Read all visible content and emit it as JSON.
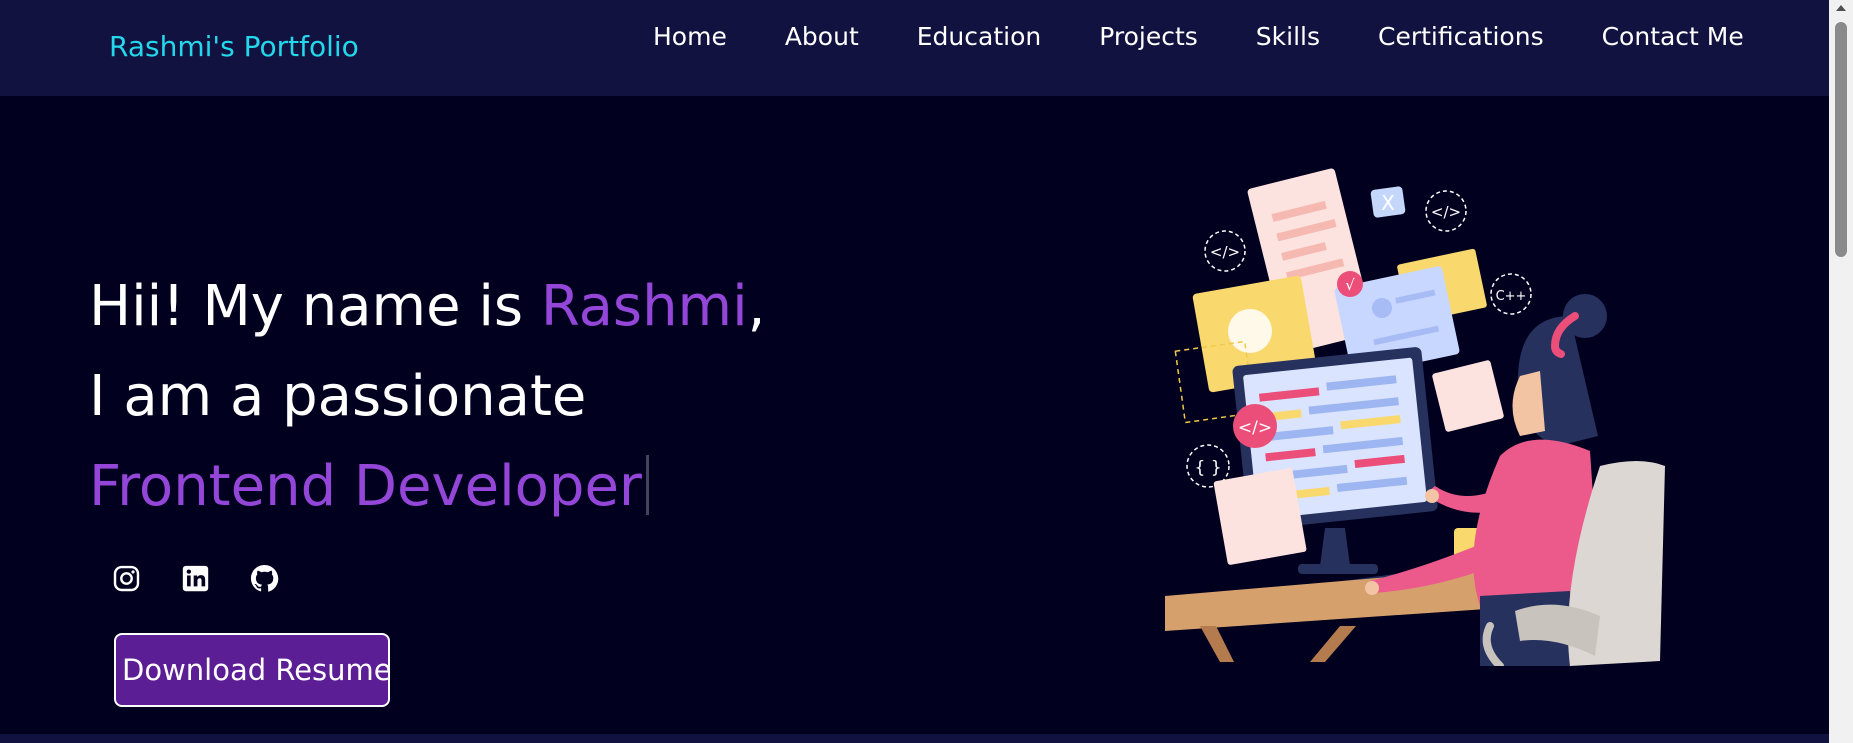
{
  "nav": {
    "brand": "Rashmi's Portfolio",
    "items": [
      "Home",
      "About",
      "Education",
      "Projects",
      "Skills",
      "Certifications",
      "Contact Me"
    ]
  },
  "hero": {
    "line1_prefix": "Hii! My name is ",
    "line1_name": "Rashmi",
    "line1_suffix": ",",
    "line2": "I am a passionate",
    "line3": "Frontend Developer"
  },
  "socials": [
    "instagram-icon",
    "linkedin-icon",
    "github-icon"
  ],
  "resume_button": "Download Resume",
  "illustration": {
    "badge_x": "X",
    "code_tag": "</>",
    "braces": "{ }",
    "cpp": "C++",
    "check": "√"
  },
  "colors": {
    "nav_bg": "#121241",
    "page_bg": "#02001f",
    "brand": "#22d8ea",
    "accent": "#9446d8",
    "button_bg": "#5b1e94"
  }
}
